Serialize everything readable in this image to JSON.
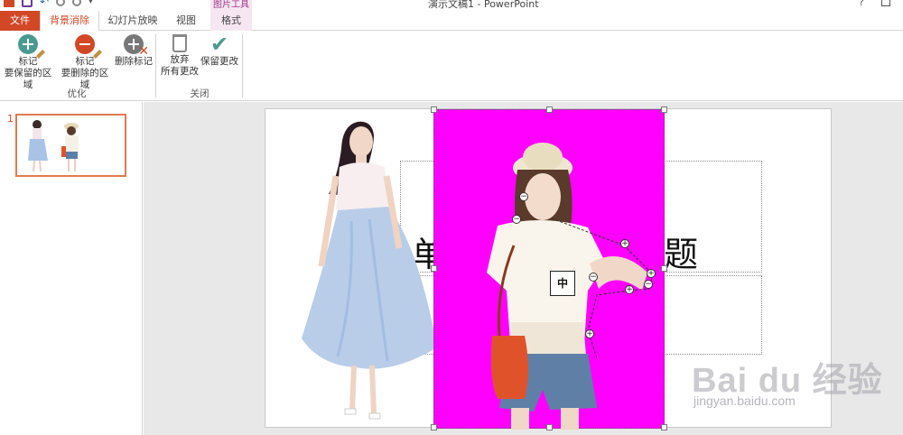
{
  "window": {
    "title": "演示文稿1 - PowerPoint",
    "help": "?"
  },
  "tabs": {
    "file": "文件",
    "background_removal": "背景消除",
    "slideshow": "幻灯片放映",
    "view": "视图",
    "format": "格式",
    "contextual_group": "图片工具"
  },
  "ribbon": {
    "mark_keep_line1": "标记",
    "mark_keep_line2": "要保留的区域",
    "mark_remove_line1": "标记",
    "mark_remove_line2": "要删除的区域",
    "delete_mark": "删除标记",
    "discard_line1": "放弃",
    "discard_line2": "所有更改",
    "keep_changes": "保留更改",
    "group_refine": "优化",
    "group_close": "关闭"
  },
  "slides_pane": {
    "slide_number": "1"
  },
  "slide": {
    "title_text_left": "单",
    "title_text_right": "题",
    "center_marker": "中"
  },
  "watermark": {
    "logo": "Bai du 经验",
    "url": "jingyan.baidu.com"
  },
  "colors": {
    "accent": "#d24726",
    "removal_overlay": "#ff00ff",
    "keep_icon": "#4a9a8f"
  }
}
